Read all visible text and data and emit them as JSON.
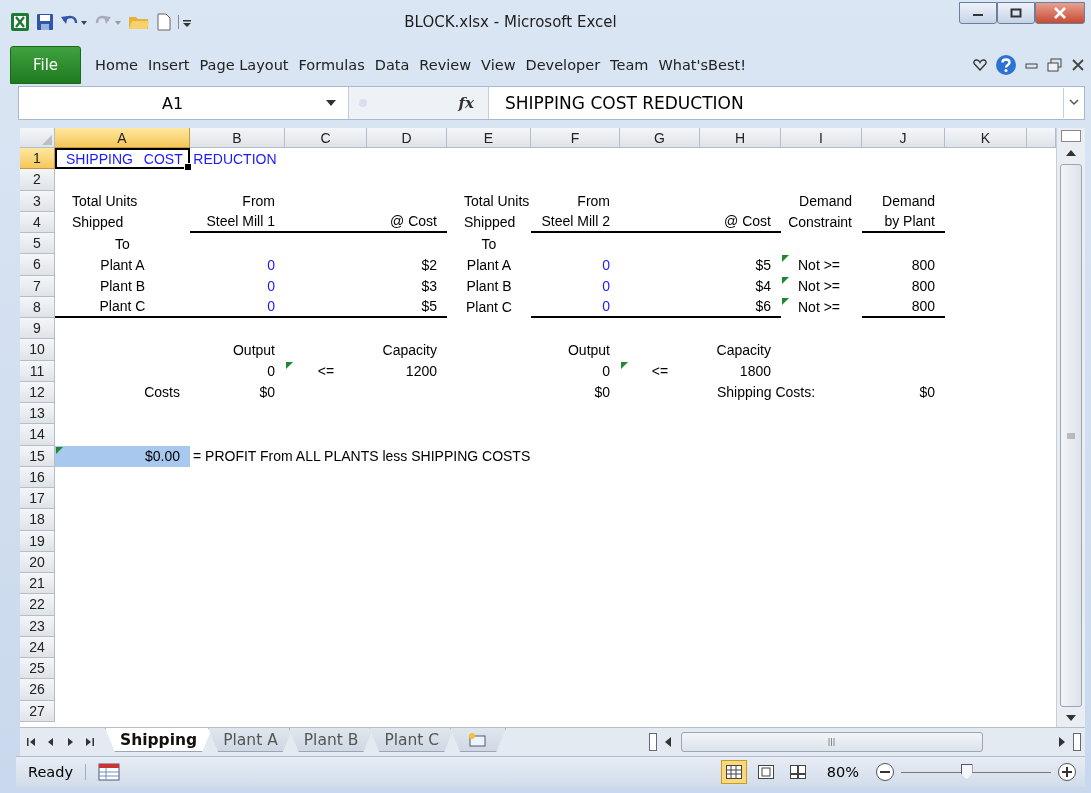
{
  "window": {
    "title": "BLOCK.xlsx  -  Microsoft Excel"
  },
  "ribbon": {
    "file_tab": "File",
    "tabs": [
      "Home",
      "Insert",
      "Page Layout",
      "Formulas",
      "Data",
      "Review",
      "View",
      "Developer",
      "Team",
      "What'sBest!"
    ]
  },
  "formula_bar": {
    "name_box": "A1",
    "function_symbol": "fx",
    "value": "SHIPPING COST REDUCTION"
  },
  "sheet": {
    "columns": [
      {
        "label": "A",
        "selected": true
      },
      {
        "label": "B",
        "selected": false
      },
      {
        "label": "C",
        "selected": false
      },
      {
        "label": "D",
        "selected": false
      },
      {
        "label": "E",
        "selected": false
      },
      {
        "label": "F",
        "selected": false
      },
      {
        "label": "G",
        "selected": false
      },
      {
        "label": "H",
        "selected": false
      },
      {
        "label": "I",
        "selected": false
      },
      {
        "label": "J",
        "selected": false
      },
      {
        "label": "K",
        "selected": false
      }
    ],
    "rows": [
      {
        "number": "1",
        "selected": true,
        "cells": [
          {
            "text": "SHIPPING COST REDUCTION",
            "kind": "title",
            "active": true
          }
        ]
      },
      {
        "number": "2",
        "selected": false
      },
      {
        "number": "3",
        "selected": false,
        "cells": [
          {
            "text": "Total Units",
            "kind": "left"
          },
          {
            "text": "From",
            "kind": "right"
          },
          {},
          {},
          {
            "text": "Total Units",
            "kind": "left"
          },
          {
            "text": "From",
            "kind": "right"
          },
          {},
          {},
          {
            "text": "Demand",
            "kind": "right"
          },
          {
            "text": "Demand",
            "kind": "right"
          }
        ]
      },
      {
        "number": "4",
        "selected": false,
        "cells": [
          {
            "text": "Shipped",
            "kind": "left"
          },
          {
            "text": "Steel Mill 1",
            "kind": "right",
            "rule": true
          },
          {
            "rule": true
          },
          {
            "text": "@ Cost",
            "kind": "right",
            "rule": true
          },
          {
            "text": "Shipped",
            "kind": "left"
          },
          {
            "text": "Steel Mill 2",
            "kind": "right",
            "rule": true
          },
          {
            "rule": true
          },
          {
            "text": "@ Cost",
            "kind": "right",
            "rule": true
          },
          {
            "text": "Constraint",
            "kind": "right"
          },
          {
            "text": "by Plant",
            "kind": "right",
            "rule": true
          }
        ]
      },
      {
        "number": "5",
        "selected": false,
        "cells": [
          {
            "text": "To",
            "kind": "center"
          },
          {},
          {},
          {},
          {
            "text": "To",
            "kind": "center"
          }
        ]
      },
      {
        "number": "6",
        "selected": false,
        "cells": [
          {
            "text": "Plant A",
            "kind": "center"
          },
          {
            "text": "0",
            "kind": "input"
          },
          {},
          {
            "text": "$2",
            "kind": "right"
          },
          {
            "text": "Plant A",
            "kind": "center"
          },
          {
            "text": "0",
            "kind": "input"
          },
          {},
          {
            "text": "$5",
            "kind": "right"
          },
          {
            "text": "Not >=",
            "kind": "left",
            "flag": true
          },
          {
            "text": "800",
            "kind": "right"
          }
        ]
      },
      {
        "number": "7",
        "selected": false,
        "cells": [
          {
            "text": "Plant B",
            "kind": "center"
          },
          {
            "text": "0",
            "kind": "input"
          },
          {},
          {
            "text": "$3",
            "kind": "right"
          },
          {
            "text": "Plant B",
            "kind": "center"
          },
          {
            "text": "0",
            "kind": "input"
          },
          {},
          {
            "text": "$4",
            "kind": "right"
          },
          {
            "text": "Not >=",
            "kind": "left",
            "flag": true
          },
          {
            "text": "800",
            "kind": "right"
          }
        ]
      },
      {
        "number": "8",
        "selected": false,
        "cells": [
          {
            "text": "Plant C",
            "kind": "center",
            "rule": true
          },
          {
            "text": "0",
            "kind": "input",
            "rule": true
          },
          {
            "rule": true
          },
          {
            "text": "$5",
            "kind": "right",
            "rule": true
          },
          {
            "text": "Plant C",
            "kind": "center"
          },
          {
            "text": "0",
            "kind": "input",
            "rule": true
          },
          {
            "rule": true
          },
          {
            "text": "$6",
            "kind": "right",
            "rule": true
          },
          {
            "text": "Not >=",
            "kind": "left",
            "flag": true
          },
          {
            "text": "800",
            "kind": "right",
            "rule": true
          }
        ]
      },
      {
        "number": "9",
        "selected": false
      },
      {
        "number": "10",
        "selected": false,
        "cells": [
          {},
          {
            "text": "Output",
            "kind": "right"
          },
          {},
          {
            "text": "Capacity",
            "kind": "right"
          },
          {},
          {
            "text": "Output",
            "kind": "right"
          },
          {},
          {
            "text": "Capacity",
            "kind": "right"
          }
        ]
      },
      {
        "number": "11",
        "selected": false,
        "cells": [
          {},
          {
            "text": "0",
            "kind": "right"
          },
          {
            "text": "<=",
            "kind": "center",
            "flag": true
          },
          {
            "text": "1200",
            "kind": "right"
          },
          {},
          {
            "text": "0",
            "kind": "right"
          },
          {
            "text": "<=",
            "kind": "center",
            "flag": true
          },
          {
            "text": "1800",
            "kind": "right"
          }
        ]
      },
      {
        "number": "12",
        "selected": false,
        "cells": [
          {
            "text": "Costs",
            "kind": "right"
          },
          {
            "text": "$0",
            "kind": "right"
          },
          {},
          {},
          {},
          {
            "text": "$0",
            "kind": "right"
          },
          {},
          {
            "text": "Shipping Costs:",
            "kind": "left"
          },
          {},
          {
            "text": "$0",
            "kind": "right"
          }
        ]
      },
      {
        "number": "13",
        "selected": false
      },
      {
        "number": "14",
        "selected": false
      },
      {
        "number": "15",
        "selected": false,
        "cells": [
          {
            "text": "$0.00",
            "kind": "right",
            "flag": true,
            "highlighted": true
          },
          {
            "text": "= PROFIT From ALL PLANTS less SHIPPING COSTS",
            "kind": "left"
          }
        ]
      },
      {
        "number": "16",
        "selected": false
      },
      {
        "number": "17",
        "selected": false
      },
      {
        "number": "18",
        "selected": false
      },
      {
        "number": "19",
        "selected": false
      },
      {
        "number": "20",
        "selected": false
      },
      {
        "number": "21",
        "selected": false
      },
      {
        "number": "22",
        "selected": false
      },
      {
        "number": "23",
        "selected": false
      },
      {
        "number": "24",
        "selected": false
      },
      {
        "number": "25",
        "selected": false
      },
      {
        "number": "26",
        "selected": false
      },
      {
        "number": "27",
        "selected": false
      }
    ]
  },
  "sheet_tabs": [
    {
      "label": "Shipping",
      "selected": true
    },
    {
      "label": "Plant A",
      "selected": false
    },
    {
      "label": "Plant B",
      "selected": false
    },
    {
      "label": "Plant C",
      "selected": false
    }
  ],
  "status_bar": {
    "mode": "Ready",
    "zoom": "80%",
    "zoom_slider": {
      "level": 0.43
    },
    "views": [
      {
        "kind": "normal",
        "selected": true
      },
      {
        "kind": "page-layout",
        "selected": false
      },
      {
        "kind": "page-break",
        "selected": false
      }
    ]
  }
}
